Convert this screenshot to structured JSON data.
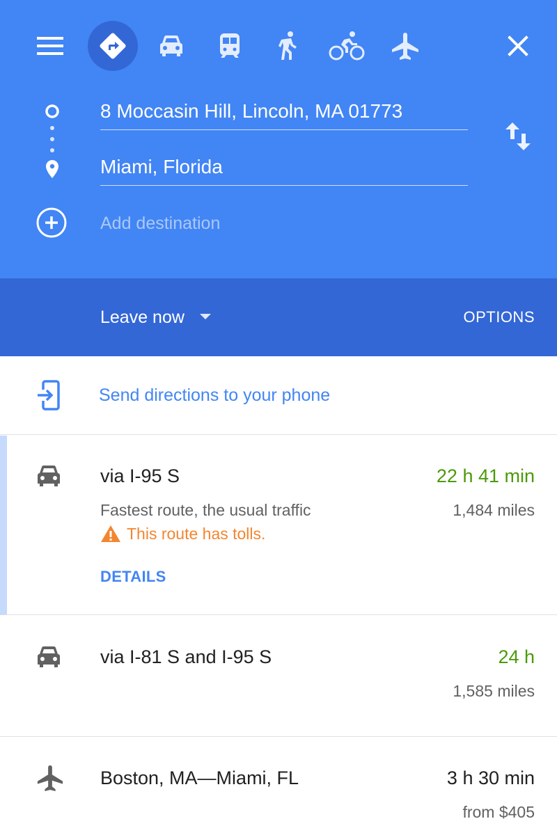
{
  "colors": {
    "header_blue": "#4285f4",
    "subbar_blue": "#3367d6",
    "link_blue": "#4285f4",
    "time_green": "#4c9a0a",
    "warning_orange": "#f4852f"
  },
  "modes": [
    {
      "name": "best-route",
      "icon": "directions-icon",
      "active": true
    },
    {
      "name": "driving",
      "icon": "car-icon",
      "active": false
    },
    {
      "name": "transit",
      "icon": "train-icon",
      "active": false
    },
    {
      "name": "walking",
      "icon": "walking-icon",
      "active": false
    },
    {
      "name": "cycling",
      "icon": "bicycle-icon",
      "active": false
    },
    {
      "name": "flights",
      "icon": "airplane-icon",
      "active": false
    }
  ],
  "search": {
    "origin": "8 Moccasin Hill, Lincoln, MA 01773",
    "destination": "Miami, Florida",
    "add_destination_placeholder": "Add destination"
  },
  "depart": {
    "leave_label": "Leave now",
    "options_label": "OPTIONS"
  },
  "send": {
    "label": "Send directions to your phone"
  },
  "routes": [
    {
      "mode_icon": "car-icon",
      "title": "via I-95 S",
      "time": "22 h 41 min",
      "description": "Fastest route, the usual traffic",
      "distance": "1,484 miles",
      "warning": "This route has tolls.",
      "details_label": "DETAILS"
    },
    {
      "mode_icon": "car-icon",
      "title": "via I-81 S and I-95 S",
      "time": "24 h",
      "distance": "1,585 miles"
    },
    {
      "mode_icon": "airplane-icon",
      "title": "Boston, MA—Miami, FL",
      "time": "3 h 30 min",
      "distance": "from $405"
    }
  ]
}
